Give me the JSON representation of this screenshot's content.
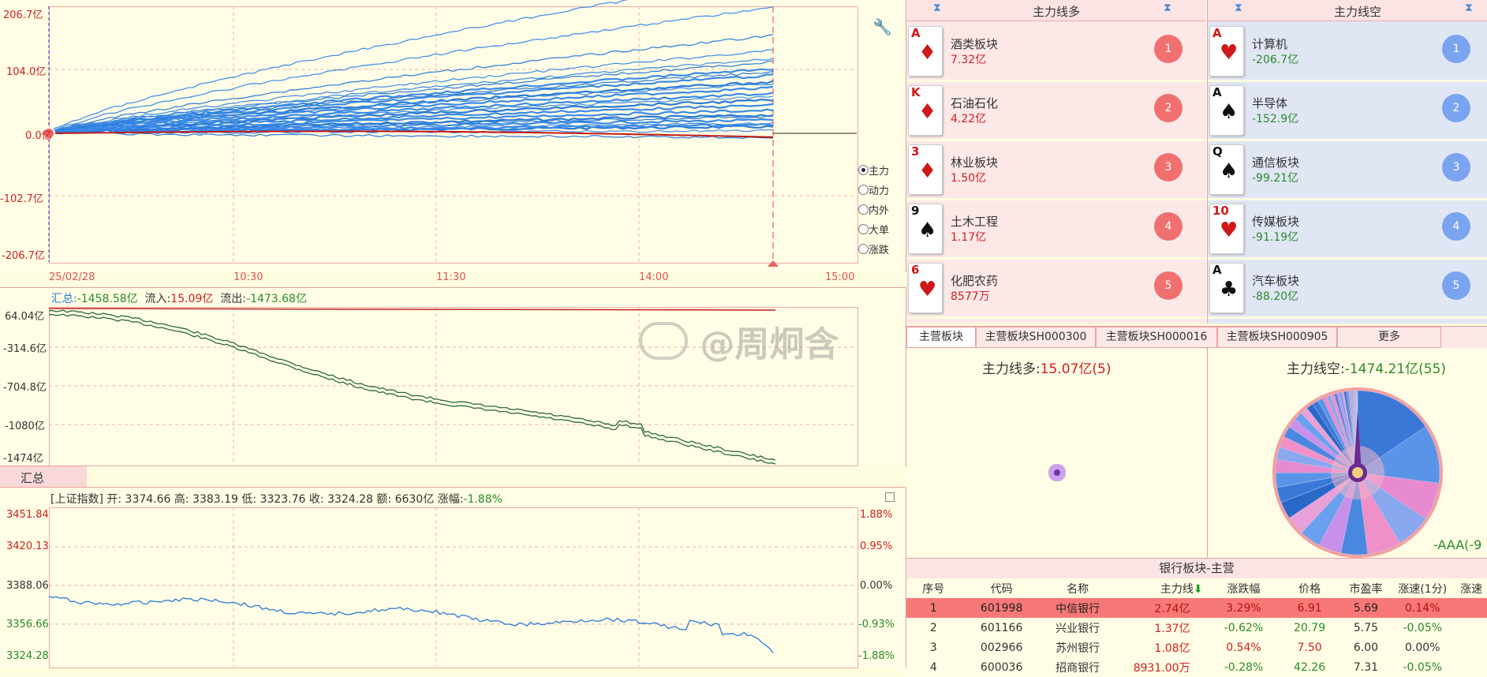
{
  "main_chart": {
    "y_ticks": [
      "206.7亿",
      "104.0亿",
      "0.0亿",
      "-102.7亿",
      "-206.7亿"
    ],
    "x_ticks": [
      "25/02/28",
      "10:30",
      "11:30",
      "14:00",
      "15:00"
    ],
    "radio_options": [
      "主力",
      "动力",
      "内外",
      "大单",
      "涨跌"
    ],
    "selected_radio": "主力"
  },
  "summary_chart": {
    "header_label": "汇总:",
    "header_total": "-1458.58亿",
    "inflow_label": "流入:",
    "inflow": "15.09亿",
    "outflow_label": "流出:",
    "outflow": "-1473.68亿",
    "y_ticks": [
      "64.04亿",
      "-314.6亿",
      "-704.8亿",
      "-1080亿",
      "-1474亿"
    ],
    "tab": "汇总"
  },
  "index_chart": {
    "info": "[上证指数] 开: 3374.66  高: 3383.19  低: 3323.76  收: 3324.28  额: 6630亿  涨幅:",
    "change": "-1.88%",
    "y_left": [
      "3451.84",
      "3420.13",
      "3388.06",
      "3356.66",
      "3324.28"
    ],
    "y_right": [
      "1.88%",
      "0.95%",
      "0.00%",
      "-0.93%",
      "-1.88%"
    ]
  },
  "long_panel": {
    "title": "主力线多",
    "items": [
      {
        "rank": "A",
        "suit": "♦",
        "color": "red",
        "name": "酒类板块",
        "value": "7.32亿",
        "num": "1"
      },
      {
        "rank": "K",
        "suit": "♦",
        "color": "red",
        "name": "石油石化",
        "value": "4.22亿",
        "num": "2"
      },
      {
        "rank": "3",
        "suit": "♦",
        "color": "red",
        "name": "林业板块",
        "value": "1.50亿",
        "num": "3"
      },
      {
        "rank": "9",
        "suit": "♠",
        "color": "blk",
        "name": "土木工程",
        "value": "1.17亿",
        "num": "4"
      },
      {
        "rank": "6",
        "suit": "♥",
        "color": "red",
        "name": "化肥农药",
        "value": "8577万",
        "num": "5"
      }
    ]
  },
  "short_panel": {
    "title": "主力线空",
    "items": [
      {
        "rank": "A",
        "suit": "♥",
        "color": "red",
        "name": "计算机",
        "value": "-206.7亿",
        "num": "1"
      },
      {
        "rank": "A",
        "suit": "♠",
        "color": "blk",
        "name": "半导体",
        "value": "-152.9亿",
        "num": "2"
      },
      {
        "rank": "Q",
        "suit": "♠",
        "color": "blk",
        "name": "通信板块",
        "value": "-99.21亿",
        "num": "3"
      },
      {
        "rank": "10",
        "suit": "♥",
        "color": "red",
        "name": "传媒板块",
        "value": "-91.19亿",
        "num": "4"
      },
      {
        "rank": "A",
        "suit": "♣",
        "color": "blk",
        "name": "汽车板块",
        "value": "-88.20亿",
        "num": "5"
      }
    ]
  },
  "tabs": [
    "主营板块",
    "主营板块SH000300",
    "主营板块SH000016",
    "主营板块SH000905",
    "更多"
  ],
  "pie_left": {
    "label": "主力线多:",
    "value": "15.07亿(5)"
  },
  "pie_right": {
    "label": "主力线空:",
    "value": "-1474.21亿(55)",
    "footer": "-AAA(-9"
  },
  "watermark": "@周炯含",
  "table": {
    "title": "银行板块-主营",
    "columns": [
      "序号",
      "代码",
      "名称",
      "主力线",
      "涨跌幅",
      "价格",
      "市盈率",
      "涨速(1分)",
      "涨速"
    ],
    "rows": [
      [
        "1",
        "601998",
        "中信银行",
        "2.74亿",
        "3.29%",
        "6.91",
        "5.69",
        "0.14%"
      ],
      [
        "2",
        "601166",
        "兴业银行",
        "1.37亿",
        "-0.62%",
        "20.79",
        "5.75",
        "-0.05%"
      ],
      [
        "3",
        "002966",
        "苏州银行",
        "1.08亿",
        "0.54%",
        "7.50",
        "6.00",
        "0.00%"
      ],
      [
        "4",
        "600036",
        "招商银行",
        "8931.00万",
        "-0.28%",
        "42.26",
        "7.31",
        "-0.05%"
      ]
    ]
  }
}
